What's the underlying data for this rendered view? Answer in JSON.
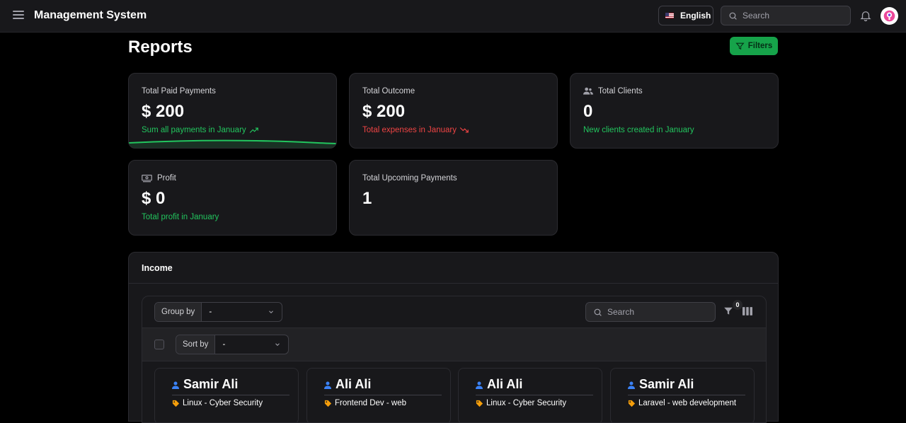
{
  "app": {
    "title": "Management System"
  },
  "header": {
    "language": "English",
    "search_placeholder": "Search"
  },
  "page": {
    "title": "Reports",
    "filters_label": "Filters"
  },
  "stats": [
    {
      "label": "Total Paid Payments",
      "value": "$ 200",
      "description": "Sum all payments in January",
      "trend": "up",
      "color": "#22c55e"
    },
    {
      "label": "Total Outcome",
      "value": "$ 200",
      "description": "Total expenses in January",
      "trend": "down",
      "color": "#ef4444"
    },
    {
      "label": "Total Clients",
      "value": "0",
      "description": "New clients created in January",
      "icon": "users-icon",
      "color": "#22c55e"
    },
    {
      "label": "Profit",
      "value": "$ 0",
      "description": "Total profit in January",
      "icon": "cash-icon",
      "color": "#22c55e"
    },
    {
      "label": "Total Upcoming Payments",
      "value": "1"
    }
  ],
  "income": {
    "title": "Income",
    "group_by_label": "Group by",
    "group_by_value": "-",
    "search_placeholder": "Search",
    "filter_count": "0",
    "sort_by_label": "Sort by",
    "sort_by_value": "-",
    "records": [
      {
        "name": "Samir Ali",
        "tag": "Linux - Cyber Security"
      },
      {
        "name": "Ali Ali",
        "tag": "Frontend Dev - web"
      },
      {
        "name": "Ali Ali",
        "tag": "Linux - Cyber Security"
      },
      {
        "name": "Samir Ali",
        "tag": "Laravel - web development"
      }
    ]
  },
  "colors": {
    "accent": "#16a34a",
    "positive": "#22c55e",
    "negative": "#ef4444",
    "user_icon": "#3b82f6",
    "tag_icon": "#f59e0b"
  }
}
